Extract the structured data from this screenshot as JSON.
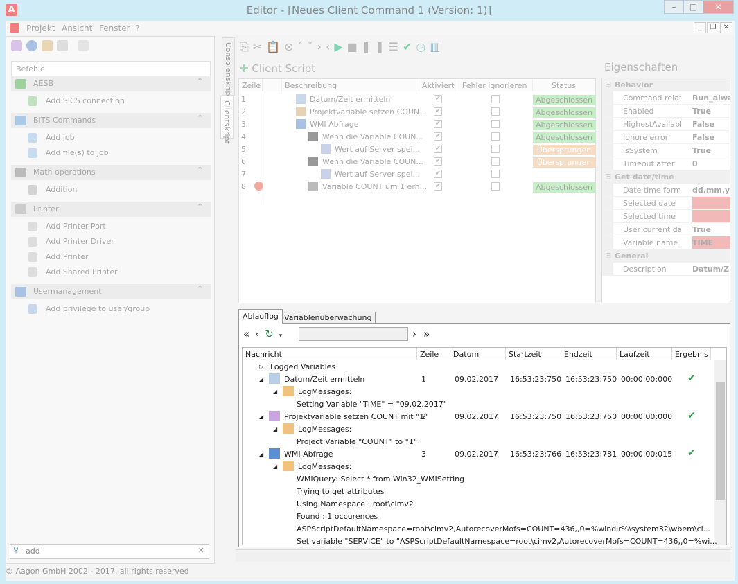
{
  "window": {
    "title": "Editor - [Neues Client Command 1 (Version: 1)]",
    "logo": "A"
  },
  "menu": [
    "Projekt",
    "Ansicht",
    "Fenster",
    "?"
  ],
  "left": {
    "header": "Befehle",
    "groups": [
      {
        "label": "AESB",
        "items": [
          "Add SICS connection"
        ]
      },
      {
        "label": "BITS Commands",
        "items": [
          "Add job",
          "Add file(s) to job"
        ]
      },
      {
        "label": "Math operations",
        "items": [
          "Addition"
        ]
      },
      {
        "label": "Printer",
        "items": [
          "Add Printer Port",
          "Add Printer Driver",
          "Add Printer",
          "Add Shared Printer"
        ]
      },
      {
        "label": "Usermanagement",
        "items": [
          "Add privilege to user/group"
        ]
      }
    ],
    "search_value": "add"
  },
  "vtabs": [
    "Consolenskript",
    "Clientskript"
  ],
  "script": {
    "title": "Client Script",
    "columns": [
      "Zeile",
      "Beschreibung",
      "Aktiviert",
      "Fehler ignorieren",
      "Status"
    ],
    "rows": [
      {
        "line": "1",
        "desc": "Datum/Zeit ermitteln",
        "active": true,
        "ignore": false,
        "status": "Abgeschlossen"
      },
      {
        "line": "2",
        "desc": "Projektvariable setzen COUN...",
        "active": true,
        "ignore": false,
        "status": "Abgeschlossen"
      },
      {
        "line": "3",
        "desc": "WMI Abfrage",
        "active": true,
        "ignore": false,
        "status": "Abgeschlossen"
      },
      {
        "line": "4",
        "desc": "Wenn die Variable COUN...",
        "active": true,
        "ignore": false,
        "status": "Abgeschlossen"
      },
      {
        "line": "5",
        "desc": "Wert auf Server spei...",
        "active": true,
        "ignore": false,
        "status": "Übersprungen"
      },
      {
        "line": "6",
        "desc": "Wenn die Variable COUN...",
        "active": true,
        "ignore": false,
        "status": "Übersprungen"
      },
      {
        "line": "7",
        "desc": "Wert auf Server spei...",
        "active": true,
        "ignore": false,
        "status": ""
      },
      {
        "line": "8",
        "desc": "Variable COUNT um 1 erh...",
        "active": true,
        "ignore": false,
        "status": "Abgeschlossen"
      }
    ]
  },
  "properties": {
    "title": "Eigenschaften",
    "categories": [
      {
        "name": "Behavior",
        "rows": [
          [
            "Command relation",
            "Run_alwa"
          ],
          [
            "Enabled",
            "True"
          ],
          [
            "HighestAvailableRig",
            "False"
          ],
          [
            "Ignore error",
            "False"
          ],
          [
            "isSystem",
            "True"
          ],
          [
            "Timeout after",
            "0"
          ]
        ]
      },
      {
        "name": "Get date/time",
        "rows": [
          [
            "Date time format",
            "dd.mm.y"
          ],
          [
            "Selected date",
            ""
          ],
          [
            "Selected time",
            ""
          ],
          [
            "User current date ti",
            "True"
          ],
          [
            "Variable name",
            "TIME"
          ]
        ]
      },
      {
        "name": "General",
        "rows": [
          [
            "Description",
            "Datum/Z"
          ]
        ]
      }
    ]
  },
  "log": {
    "tabs": [
      "Ablauflog",
      "Variablenüberwachung"
    ],
    "columns": [
      "Nachricht",
      "Zeile",
      "Datum",
      "Startzeit",
      "Endzeit",
      "Laufzeit",
      "Ergebnis"
    ],
    "rows": [
      {
        "lvl": 0,
        "text": "Logged Variables",
        "exp": "▷"
      },
      {
        "lvl": 0,
        "text": "Datum/Zeit ermitteln",
        "exp": "◢",
        "icon": "calendar",
        "line": "1",
        "date": "09.02.2017",
        "start": "16:53:23:750",
        "end": "16:53:23:750",
        "dur": "00:00:00:000",
        "ok": "✔"
      },
      {
        "lvl": 1,
        "text": "LogMessages:",
        "exp": "◢",
        "icon": "folder"
      },
      {
        "lvl": 2,
        "text": "Setting Variable \"TIME\" = \"09.02.2017\""
      },
      {
        "lvl": 0,
        "text": "Projektvariable setzen COUNT mit \"1\"",
        "exp": "◢",
        "icon": "variable",
        "line": "2",
        "date": "09.02.2017",
        "start": "16:53:23:750",
        "end": "16:53:23:750",
        "dur": "00:00:00:000",
        "ok": "✔"
      },
      {
        "lvl": 1,
        "text": "LogMessages:",
        "exp": "◢",
        "icon": "folder"
      },
      {
        "lvl": 2,
        "text": "Project Variable \"COUNT\" to \"1\""
      },
      {
        "lvl": 0,
        "text": "WMI Abfrage",
        "exp": "◢",
        "icon": "wmi",
        "line": "3",
        "date": "09.02.2017",
        "start": "16:53:23:766",
        "end": "16:53:23:781",
        "dur": "00:00:00:015",
        "ok": "✔"
      },
      {
        "lvl": 1,
        "text": "LogMessages:",
        "exp": "◢",
        "icon": "folder"
      },
      {
        "lvl": 2,
        "text": "WMIQuery: Select * from Win32_WMISetting"
      },
      {
        "lvl": 2,
        "text": "Trying to get attributes"
      },
      {
        "lvl": 2,
        "text": "Using Namespace : root\\cimv2"
      },
      {
        "lvl": 2,
        "text": "Found : 1 occurences"
      },
      {
        "lvl": 2,
        "text": "  ASPScriptDefaultNamespace=root\\cimv2,AutorecoverMofs=COUNT=436,,0=%windir%\\system32\\wbem\\ci..."
      },
      {
        "lvl": 2,
        "text": "Set variable \"SERVICE\" to \"ASPScriptDefaultNamespace=root\\cimv2,AutorecoverMofs=COUNT=436,,0=%wi..."
      }
    ]
  },
  "footer": "© Aagon GmbH 2002 - 2017, all rights reserved",
  "colors": {
    "done": "#c7efc7",
    "skipped": "#f6dcc2",
    "error": "#f2b9b9",
    "ok": "#2e9b4a",
    "titlebar": "#cfecf7"
  }
}
